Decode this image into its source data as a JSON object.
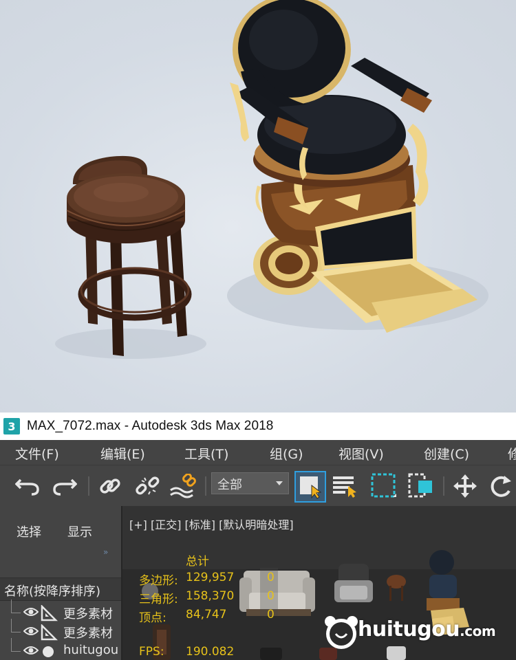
{
  "window": {
    "title": "MAX_7072.max - Autodesk 3ds Max 2018",
    "app_icon_glyph": "3"
  },
  "menubar": {
    "items": [
      {
        "label": "文件(F)"
      },
      {
        "label": "编辑(E)"
      },
      {
        "label": "工具(T)"
      },
      {
        "label": "组(G)"
      },
      {
        "label": "视图(V)"
      },
      {
        "label": "创建(C)"
      },
      {
        "label": "修"
      }
    ]
  },
  "toolbar": {
    "selection_filter_value": "全部",
    "icons": [
      "undo-icon",
      "redo-icon",
      "link-icon",
      "unlink-icon",
      "bind-space-warp-icon",
      "select-object-icon",
      "select-by-name-icon",
      "rect-selection-region-icon",
      "window-crossing-icon",
      "move-icon",
      "rotate-icon"
    ]
  },
  "explorer": {
    "tabs": [
      "选择",
      "显示"
    ],
    "expand_glyph": "»",
    "column_header": "名称(按降序排序)",
    "rows": [
      {
        "label": "更多素材",
        "kind": "helper"
      },
      {
        "label": "更多素材",
        "kind": "helper"
      },
      {
        "label": "huitugou",
        "kind": "geometry"
      }
    ]
  },
  "viewport": {
    "label": "[+] [正交] [标准] [默认明暗处理]",
    "stats": {
      "header": "总计",
      "polys_label": "多边形:",
      "polys_value": "129,957",
      "polys_sel": "0",
      "tris_label": "三角形:",
      "tris_value": "158,370",
      "tris_sel": "0",
      "verts_label": "顶点:",
      "verts_value": "84,747",
      "verts_sel": "0",
      "fps_label": "FPS:",
      "fps_value": "190.082"
    }
  },
  "watermark": {
    "text": "huitugou",
    "suffix": ".com"
  },
  "colors": {
    "menu_bg": "#444444",
    "stat_text": "#e7c21a",
    "select_highlight": "#2f9fe0",
    "icon_accent": "#1fa3a8"
  }
}
